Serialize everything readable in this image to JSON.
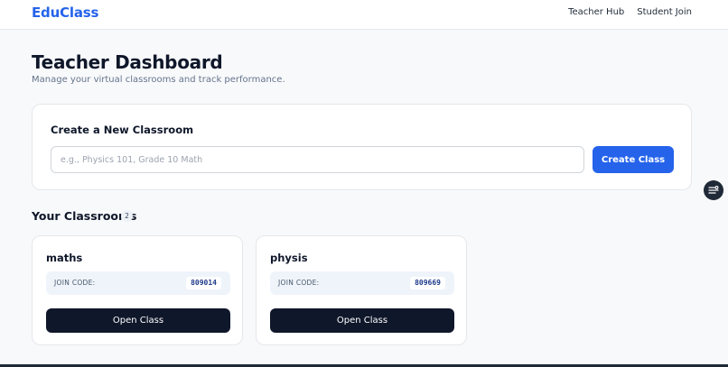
{
  "header": {
    "brand": "EduClass",
    "nav": [
      {
        "label": "Teacher Hub"
      },
      {
        "label": "Student Join"
      }
    ]
  },
  "page": {
    "title": "Teacher Dashboard",
    "subtitle": "Manage your virtual classrooms and track performance."
  },
  "create": {
    "title": "Create a New Classroom",
    "input_value": "",
    "input_placeholder": "e.g., Physics 101, Grade 10 Math",
    "button_label": "Create Class"
  },
  "classrooms": {
    "title": "Your Classrooms",
    "count": "2",
    "items": [
      {
        "name": "maths",
        "code_label": "JOIN CODE:",
        "code": "809014",
        "open_label": "Open Class"
      },
      {
        "name": "physis",
        "code_label": "JOIN CODE:",
        "code": "809669",
        "open_label": "Open Class"
      }
    ]
  },
  "floating": {
    "icon": "list-settings-icon"
  },
  "colors": {
    "brand": "#2563eb",
    "primary_button": "#2563eb",
    "dark_button": "#0f172a",
    "code_box": "#eff4fb"
  }
}
